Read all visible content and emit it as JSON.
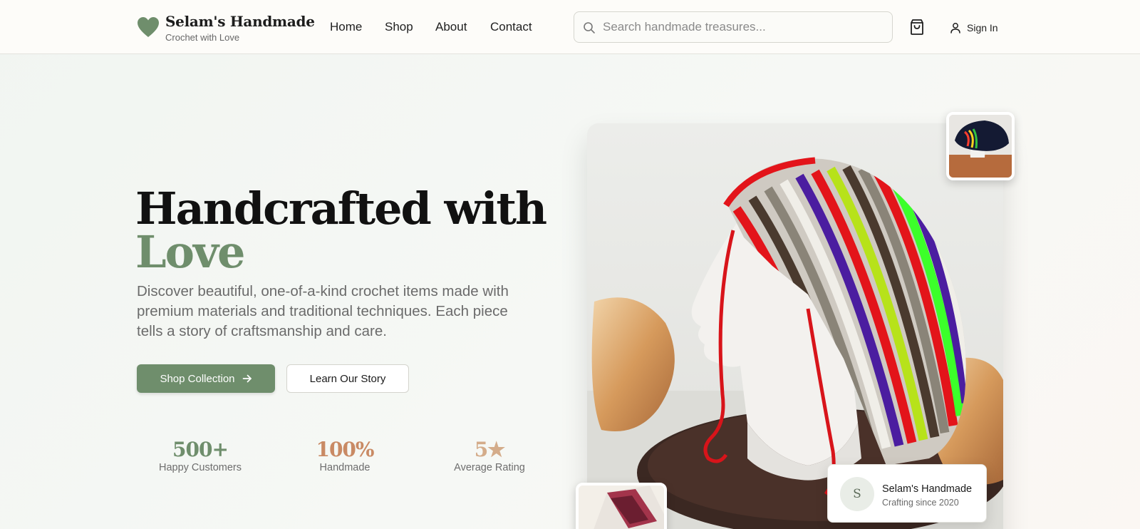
{
  "header": {
    "brand_name": "Selam's Handmade",
    "brand_tagline": "Crochet with Love",
    "nav": [
      {
        "label": "Home"
      },
      {
        "label": "Shop"
      },
      {
        "label": "About"
      },
      {
        "label": "Contact"
      }
    ],
    "search": {
      "placeholder": "Search handmade treasures...",
      "value": ""
    },
    "cart_icon": "shopping-bag-icon",
    "signin_label": "Sign In"
  },
  "hero": {
    "title_line1": "Handcrafted with",
    "title_line2": "Love",
    "description": "Discover beautiful, one-of-a-kind crochet items made with premium materials and traditional techniques. Each piece tells a story of craftsmanship and care.",
    "primary_button": "Shop Collection",
    "secondary_button": "Learn Our Story",
    "stats": [
      {
        "value": "500+",
        "label": "Happy Customers",
        "color": "#6f8e6c"
      },
      {
        "value": "100%",
        "label": "Handmade",
        "color": "#c98a64"
      },
      {
        "value": "5★",
        "label": "Average Rating",
        "color": "#d4ac8a"
      }
    ]
  },
  "maker_card": {
    "avatar_initial": "S",
    "name": "Selam's Handmade",
    "subtitle": "Crafting since 2020"
  },
  "colors": {
    "accent": "#6f8e6c",
    "accent_warm": "#c98a64"
  }
}
